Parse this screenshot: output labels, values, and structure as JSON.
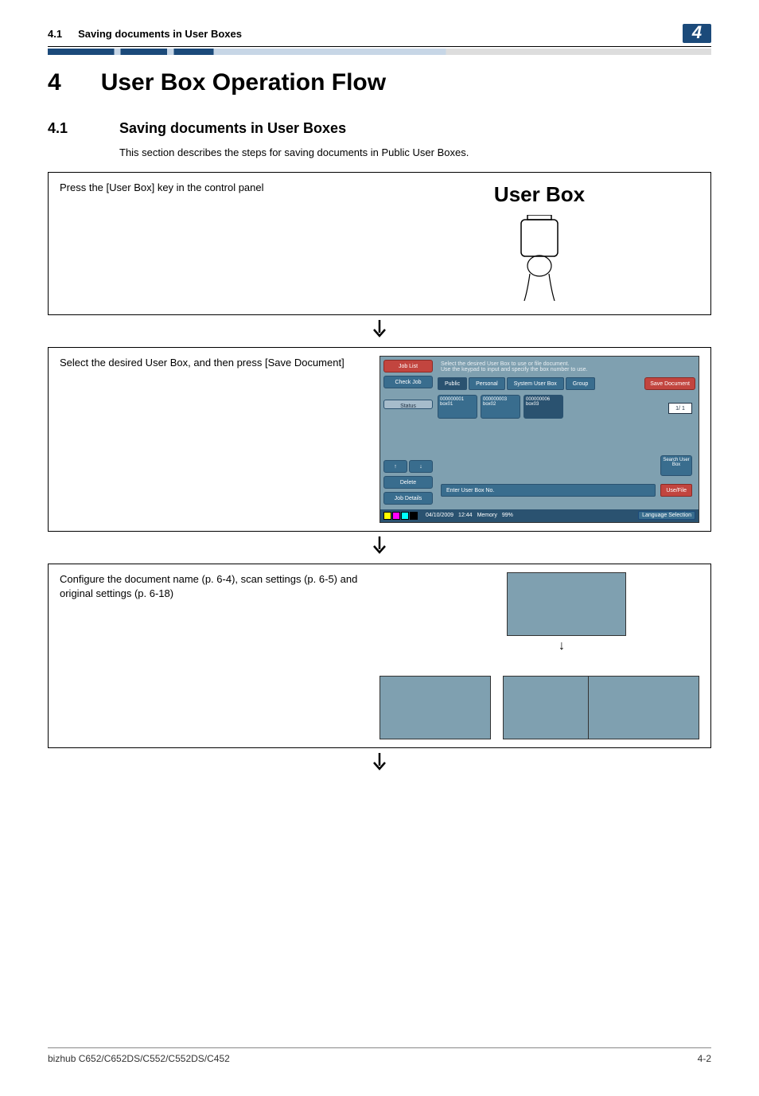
{
  "header": {
    "section_num": "4.1",
    "breadcrumb": "Saving documents in User Boxes",
    "chapter_badge": "4"
  },
  "chapter": {
    "num": "4",
    "title": "User Box Operation Flow"
  },
  "section": {
    "num": "4.1",
    "title": "Saving documents in User Boxes",
    "intro": "This section describes the steps for saving documents in Public User Boxes."
  },
  "step1": {
    "text": "Press the [User Box] key in the control panel",
    "key_label": "User Box"
  },
  "step2": {
    "text": "Select the desired User Box, and then press [Save Document]",
    "side": {
      "job_list": "Job List",
      "check_job": "Check Job",
      "status": "Status",
      "up": "↑",
      "down": "↓",
      "delete": "Delete",
      "job_details": "Job Details"
    },
    "hint": "Select the desired User Box to use or file document.\nUse the keypad to input and specify the box number to use.",
    "tabs": {
      "public": "Public",
      "personal": "Personal",
      "system": "System User Box",
      "group": "Group"
    },
    "save": "Save Document",
    "boxes": [
      {
        "id": "000000001",
        "name": "box01"
      },
      {
        "id": "000000003",
        "name": "box02"
      },
      {
        "id": "000000006",
        "name": "box03"
      }
    ],
    "pager": "1/ 1",
    "search": "Search User Box",
    "enter": "Enter User Box No.",
    "usefile": "Use/File",
    "status": {
      "date": "04/10/2009",
      "time": "12:44",
      "memory": "Memory",
      "mempct": "99%",
      "lang": "Language Selection"
    },
    "ink": [
      "#ffff00",
      "#ff00ff",
      "#00ffff",
      "#000000"
    ]
  },
  "step3": {
    "text": "Configure the document name (p. 6-4), scan settings (p. 6-5) and original settings (p. 6-18)"
  },
  "footer": {
    "model": "bizhub C652/C652DS/C552/C552DS/C452",
    "page": "4-2"
  }
}
